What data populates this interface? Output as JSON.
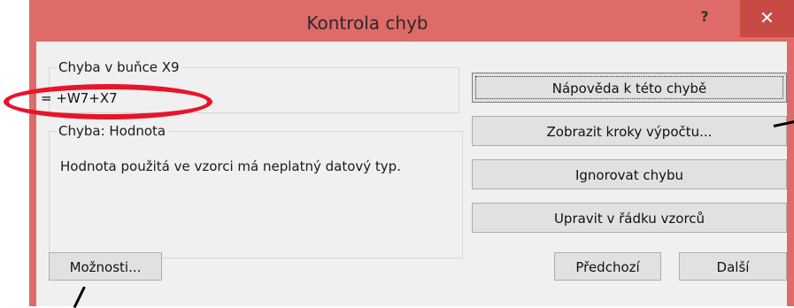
{
  "window": {
    "title": "Kontrola chyb",
    "help_glyph": "?",
    "close_glyph": "✕",
    "title_bar_color": "#de6b68",
    "close_button_color": "#c74a44"
  },
  "error_cell": {
    "legend": "Chyba v buňce X9",
    "formula": "= +W7+X7"
  },
  "error_info": {
    "legend": "Chyba: Hodnota",
    "description": "Hodnota použitá ve vzorci má neplatný datový typ."
  },
  "actions": {
    "help": "Nápověda k této chybě",
    "show_steps": "Zobrazit kroky výpočtu...",
    "ignore": "Ignorovat chybu",
    "edit_in_bar": "Upravit v řádku vzorců"
  },
  "footer": {
    "options": "Možnosti...",
    "previous": "Předchozí",
    "next": "Další"
  },
  "annotation": {
    "ellipse_color": "#e8142a"
  }
}
